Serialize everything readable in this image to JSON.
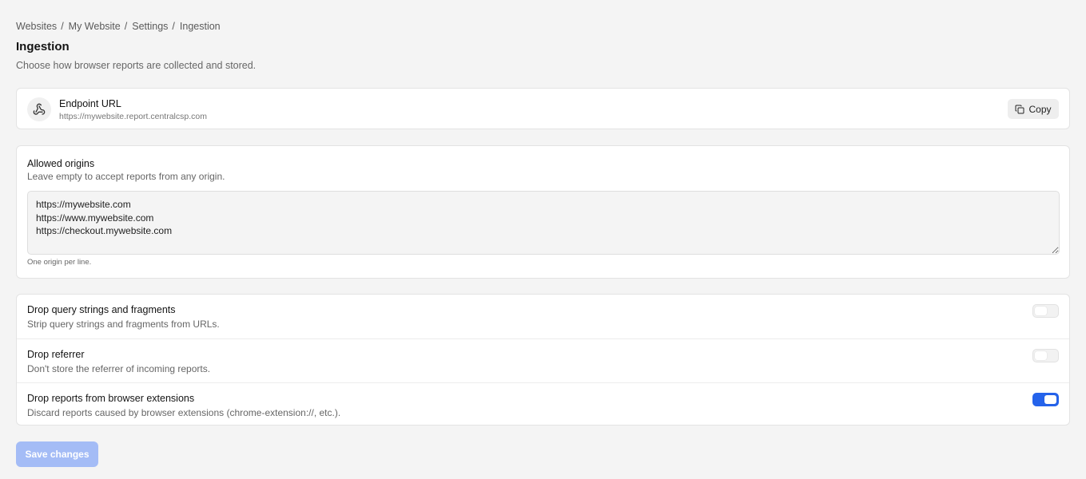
{
  "breadcrumb": {
    "items": [
      "Websites",
      "My Website",
      "Settings"
    ],
    "current": "Ingestion",
    "separator": "/"
  },
  "page": {
    "title": "Ingestion",
    "subtitle": "Choose how browser reports are collected and stored."
  },
  "endpoint": {
    "icon": "webhook-icon",
    "title": "Endpoint URL",
    "url": "https://mywebsite.report.centralcsp.com",
    "copy_label": "Copy",
    "copy_icon": "copy-icon"
  },
  "allowed_origins": {
    "title": "Allowed origins",
    "description": "Leave empty to accept reports from any origin.",
    "value": "https://mywebsite.com\nhttps://www.mywebsite.com\nhttps://checkout.mywebsite.com",
    "hint": "One origin per line."
  },
  "options": [
    {
      "title": "Drop query strings and fragments",
      "description": "Strip query strings and fragments from URLs.",
      "enabled": false
    },
    {
      "title": "Drop referrer",
      "description": "Don't store the referrer of incoming reports.",
      "enabled": false
    },
    {
      "title": "Drop reports from browser extensions",
      "description": "Discard reports caused by browser extensions (chrome-extension://, etc.).",
      "enabled": true
    }
  ],
  "save_label": "Save changes",
  "colors": {
    "accent": "#2563eb",
    "save_disabled": "#a4bcf6"
  }
}
